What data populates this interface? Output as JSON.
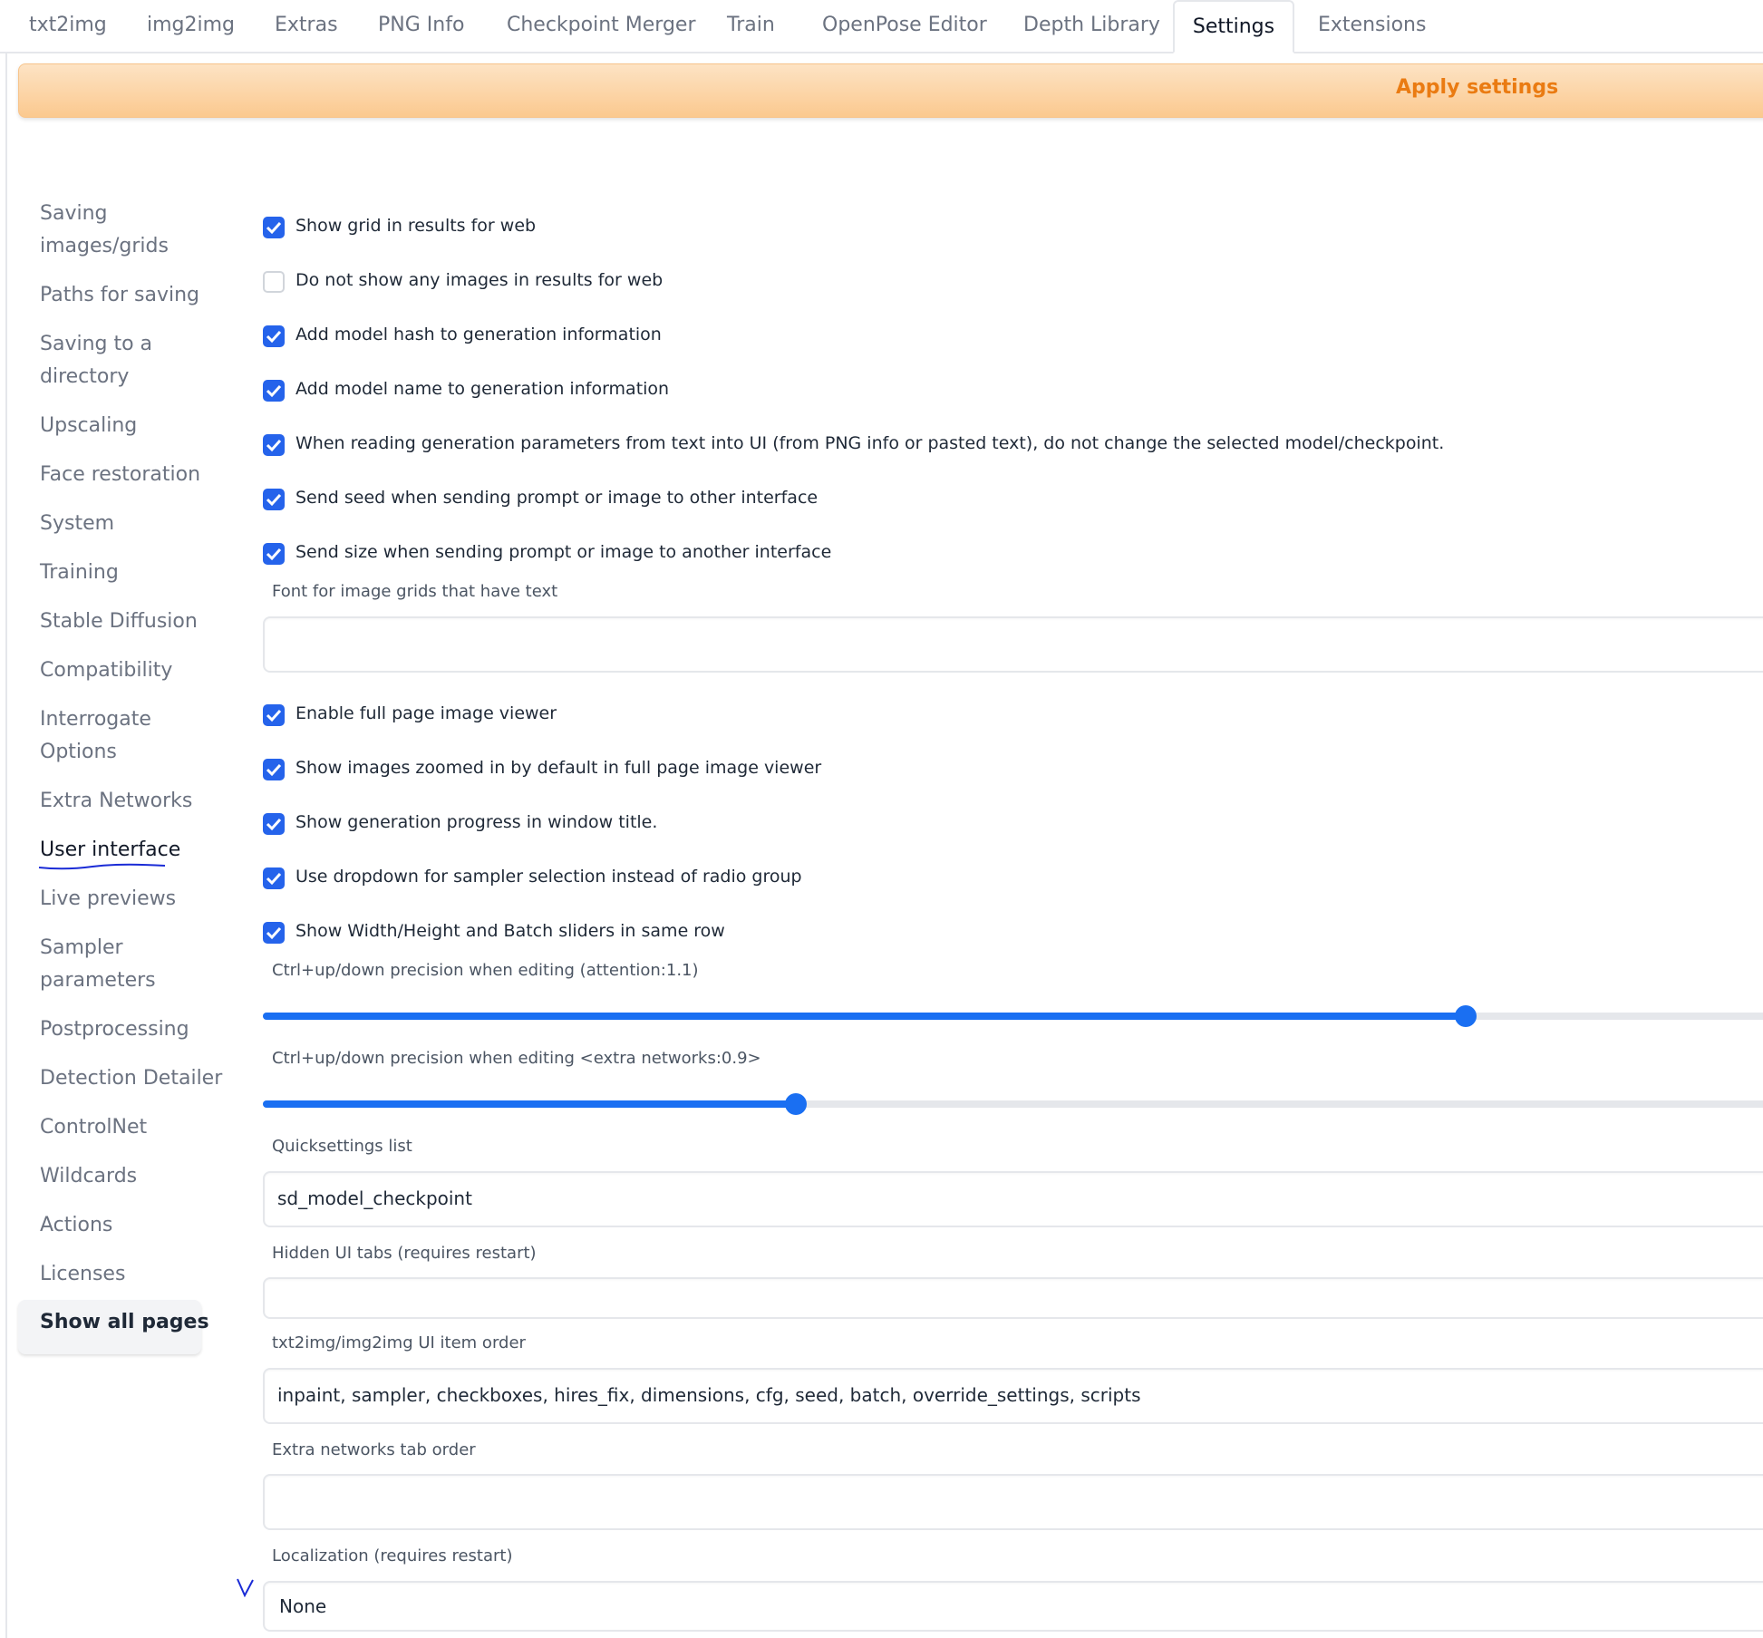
{
  "tabs": [
    {
      "label": "txt2img"
    },
    {
      "label": "img2img"
    },
    {
      "label": "Extras"
    },
    {
      "label": "PNG Info"
    },
    {
      "label": "Checkpoint Merger"
    },
    {
      "label": "Train"
    },
    {
      "label": "OpenPose Editor"
    },
    {
      "label": "Depth Library"
    },
    {
      "label": "Settings",
      "active": true
    },
    {
      "label": "Extensions"
    }
  ],
  "apply": {
    "label": "Apply settings"
  },
  "sidebar": {
    "items": [
      {
        "line1": "Saving",
        "line2": "images/grids"
      },
      {
        "line1": "Paths for saving"
      },
      {
        "line1": "Saving to a",
        "line2": "directory"
      },
      {
        "line1": "Upscaling"
      },
      {
        "line1": "Face restoration"
      },
      {
        "line1": "System"
      },
      {
        "line1": "Training"
      },
      {
        "line1": "Stable Diffusion"
      },
      {
        "line1": "Compatibility"
      },
      {
        "line1": "Interrogate",
        "line2": "Options"
      },
      {
        "line1": "Extra Networks"
      },
      {
        "line1": "User interface",
        "selected": true
      },
      {
        "line1": "Live previews"
      },
      {
        "line1": "Sampler",
        "line2": "parameters"
      },
      {
        "line1": "Postprocessing"
      },
      {
        "line1": "Detection Detailer"
      },
      {
        "line1": "ControlNet"
      },
      {
        "line1": "Wildcards"
      },
      {
        "line1": "Actions"
      },
      {
        "line1": "Licenses"
      }
    ],
    "show_all": "Show all pages"
  },
  "settings": {
    "checkboxes_top": [
      {
        "label": "Show grid in results for web",
        "checked": true
      },
      {
        "label": "Do not show any images in results for web",
        "checked": false
      },
      {
        "label": "Add model hash to generation information",
        "checked": true
      },
      {
        "label": "Add model name to generation information",
        "checked": true
      },
      {
        "label": "When reading generation parameters from text into UI (from PNG info or pasted text), do not change the selected model/checkpoint.",
        "checked": true
      },
      {
        "label": "Send seed when sending prompt or image to other interface",
        "checked": true
      },
      {
        "label": "Send size when sending prompt or image to another interface",
        "checked": true
      }
    ],
    "font_label": "Font for image grids that have text",
    "font_value": "",
    "checkboxes_mid": [
      {
        "label": "Enable full page image viewer",
        "checked": true
      },
      {
        "label": "Show images zoomed in by default in full page image viewer",
        "checked": true
      },
      {
        "label": "Show generation progress in window title.",
        "checked": true
      },
      {
        "label": "Use dropdown for sampler selection instead of radio group",
        "checked": true
      },
      {
        "label": "Show Width/Height and Batch sliders in same row",
        "checked": true
      }
    ],
    "slider1": {
      "label": "Ctrl+up/down precision when editing (attention:1.1)",
      "fill": 0.79
    },
    "slider2": {
      "label": "Ctrl+up/down precision when editing <extra networks:0.9>",
      "fill": 0.35
    },
    "quicksettings": {
      "label": "Quicksettings list",
      "value": "sd_model_checkpoint"
    },
    "hidden_tabs": {
      "label": "Hidden UI tabs (requires restart)",
      "value": ""
    },
    "ui_order": {
      "label": "txt2img/img2img UI item order",
      "value": "inpaint, sampler, checkboxes, hires_fix, dimensions, cfg, seed, batch, override_settings, scripts"
    },
    "extra_networks_order": {
      "label": "Extra networks tab order",
      "value": ""
    },
    "localization": {
      "label": "Localization (requires restart)",
      "value": "None"
    }
  },
  "colors": {
    "accent": "#2563eb",
    "apply_text": "#ea7b12",
    "annotation": "#1a2bd6"
  }
}
